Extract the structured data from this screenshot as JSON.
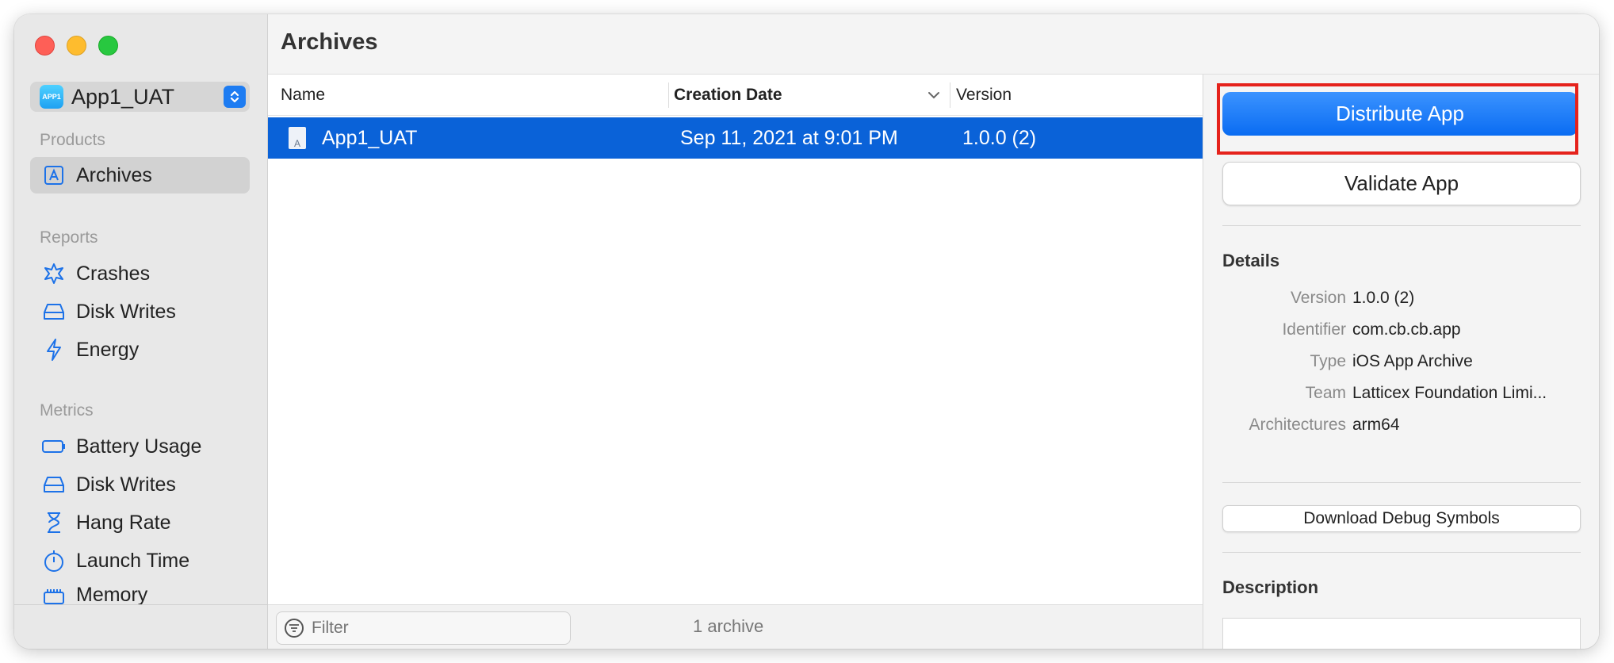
{
  "window": {
    "title": "Archives"
  },
  "sidebar": {
    "scheme": {
      "icon_text": "APP1",
      "name": "App1_UAT"
    },
    "sections": [
      {
        "heading": "Products"
      },
      {
        "heading": "Reports"
      },
      {
        "heading": "Metrics"
      }
    ],
    "items": [
      {
        "label": "Archives",
        "icon": "archives-icon"
      },
      {
        "label": "Crashes",
        "icon": "crashes-icon"
      },
      {
        "label": "Disk Writes",
        "icon": "disk-icon"
      },
      {
        "label": "Energy",
        "icon": "energy-icon"
      },
      {
        "label": "Battery Usage",
        "icon": "battery-icon"
      },
      {
        "label": "Disk Writes",
        "icon": "disk-icon"
      },
      {
        "label": "Hang Rate",
        "icon": "hourglass-icon"
      },
      {
        "label": "Launch Time",
        "icon": "stopwatch-icon"
      },
      {
        "label": "Memory",
        "icon": "memory-icon"
      }
    ]
  },
  "table": {
    "columns": {
      "name": "Name",
      "date": "Creation Date",
      "version": "Version"
    },
    "rows": [
      {
        "name": "App1_UAT",
        "date": "Sep 11, 2021 at 9:01 PM",
        "version": "1.0.0 (2)"
      }
    ]
  },
  "bottombar": {
    "filter_placeholder": "Filter",
    "count": "1 archive"
  },
  "inspector": {
    "distribute_label": "Distribute App",
    "validate_label": "Validate App",
    "details_heading": "Details",
    "details": [
      {
        "key": "Version",
        "value": "1.0.0 (2)"
      },
      {
        "key": "Identifier",
        "value": "com.cb.cb.app"
      },
      {
        "key": "Type",
        "value": "iOS App Archive"
      },
      {
        "key": "Team",
        "value": "Latticex Foundation Limi..."
      },
      {
        "key": "Architectures",
        "value": "arm64"
      }
    ],
    "debug_symbols_label": "Download Debug Symbols",
    "description_heading": "Description"
  },
  "colors": {
    "accent": "#0a62d8",
    "highlight": "#e5221b"
  }
}
